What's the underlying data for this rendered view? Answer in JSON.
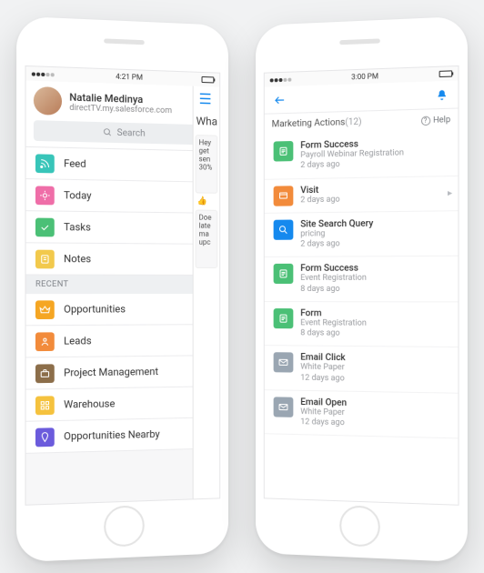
{
  "left": {
    "status_time": "4:21 PM",
    "user": {
      "name": "Natalie Medinya",
      "org": "directTV.my.salesforce.com"
    },
    "search_placeholder": "Search",
    "nav": [
      {
        "label": "Feed",
        "color": "#38c5b9",
        "icon": "rss"
      },
      {
        "label": "Today",
        "color": "#ef6ea8",
        "icon": "sun"
      },
      {
        "label": "Tasks",
        "color": "#4bc076",
        "icon": "check"
      },
      {
        "label": "Notes",
        "color": "#f2c94c",
        "icon": "note"
      }
    ],
    "recent_label": "RECENT",
    "recent": [
      {
        "label": "Opportunities",
        "color": "#f5a623",
        "icon": "crown"
      },
      {
        "label": "Leads",
        "color": "#f28b3b",
        "icon": "lead"
      },
      {
        "label": "Project Management",
        "color": "#8c6e4a",
        "icon": "briefcase"
      },
      {
        "label": "Warehouse",
        "color": "#f5c23e",
        "icon": "grid"
      },
      {
        "label": "Opportunities Nearby",
        "color": "#6b5bdc",
        "icon": "pin"
      }
    ],
    "peek": {
      "heading": "Wha",
      "card1": "Hey get sen 30%",
      "card2": "Doe late ma upc"
    }
  },
  "right": {
    "status_time": "3:00 PM",
    "title": "Marketing Actions",
    "count": "(12)",
    "help_label": "Help",
    "items": [
      {
        "title": "Form Success",
        "sub": "Payroll Webinar Registration",
        "date": "2 days ago",
        "color": "#4bc076",
        "icon": "form"
      },
      {
        "title": "Visit",
        "sub": "",
        "date": "2 days ago",
        "color": "#f28b3b",
        "icon": "visit",
        "chev": true
      },
      {
        "title": "Site Search Query",
        "sub": "pricing",
        "date": "2 days ago",
        "color": "#1589ee",
        "icon": "search"
      },
      {
        "title": "Form Success",
        "sub": "Event Registration",
        "date": "8 days ago",
        "color": "#4bc076",
        "icon": "form"
      },
      {
        "title": "Form",
        "sub": "Event Registration",
        "date": "8 days ago",
        "color": "#4bc076",
        "icon": "form"
      },
      {
        "title": "Email Click",
        "sub": "White Paper",
        "date": "12 days ago",
        "color": "#9aa6b2",
        "icon": "mail"
      },
      {
        "title": "Email Open",
        "sub": "White Paper",
        "date": "12 days ago",
        "color": "#9aa6b2",
        "icon": "mail"
      }
    ]
  }
}
